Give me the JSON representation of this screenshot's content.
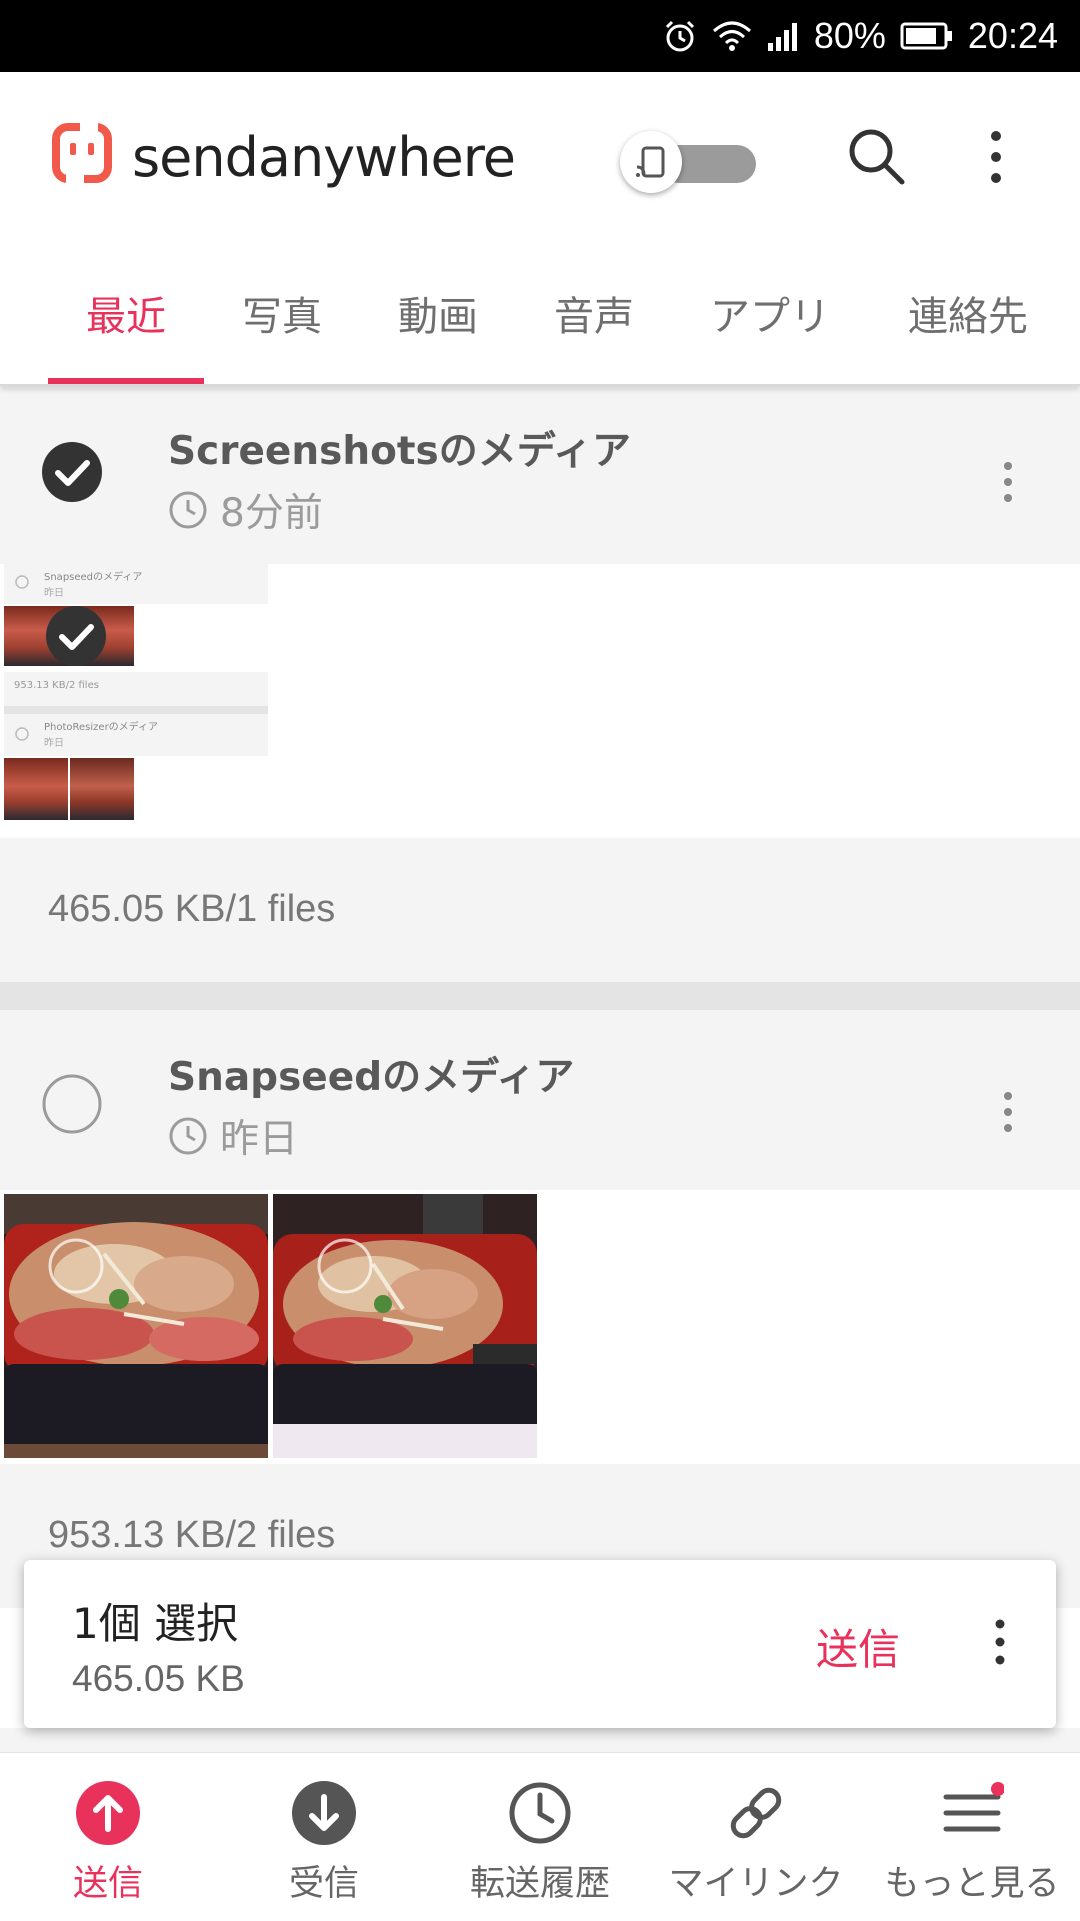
{
  "status_bar": {
    "battery_percent": "80%",
    "time": "20:24"
  },
  "header": {
    "logo_text": "sendanywhere"
  },
  "tabs": [
    {
      "label": "最近",
      "active": true
    },
    {
      "label": "写真",
      "active": false
    },
    {
      "label": "動画",
      "active": false
    },
    {
      "label": "音声",
      "active": false
    },
    {
      "label": "アプリ",
      "active": false
    },
    {
      "label": "連絡先",
      "active": false
    }
  ],
  "groups": [
    {
      "title": "Screenshotsのメディア",
      "time": "8分前",
      "files": "465.05 KB/1 files",
      "selected": true,
      "mini": {
        "title1": "Snapseedのメディア",
        "time1": "昨日",
        "files1": "953.13 KB/2 files",
        "title2": "PhotoResizerのメディア",
        "time2": "昨日"
      }
    },
    {
      "title": "Snapseedのメディア",
      "time": "昨日",
      "files": "953.13 KB/2 files",
      "selected": false
    }
  ],
  "selection_bar": {
    "count": "1個 選択",
    "size": "465.05 KB",
    "send_label": "送信"
  },
  "bottom_nav": [
    {
      "label": "送信",
      "icon": "upload-icon",
      "active": true
    },
    {
      "label": "受信",
      "icon": "download-icon",
      "active": false
    },
    {
      "label": "転送履歴",
      "icon": "history-icon",
      "active": false
    },
    {
      "label": "マイリンク",
      "icon": "link-icon",
      "active": false
    },
    {
      "label": "もっと見る",
      "icon": "menu-icon",
      "active": false
    }
  ],
  "colors": {
    "accent": "#e8325c",
    "status_bar": "#000000",
    "group_bg": "#f4f4f4"
  }
}
